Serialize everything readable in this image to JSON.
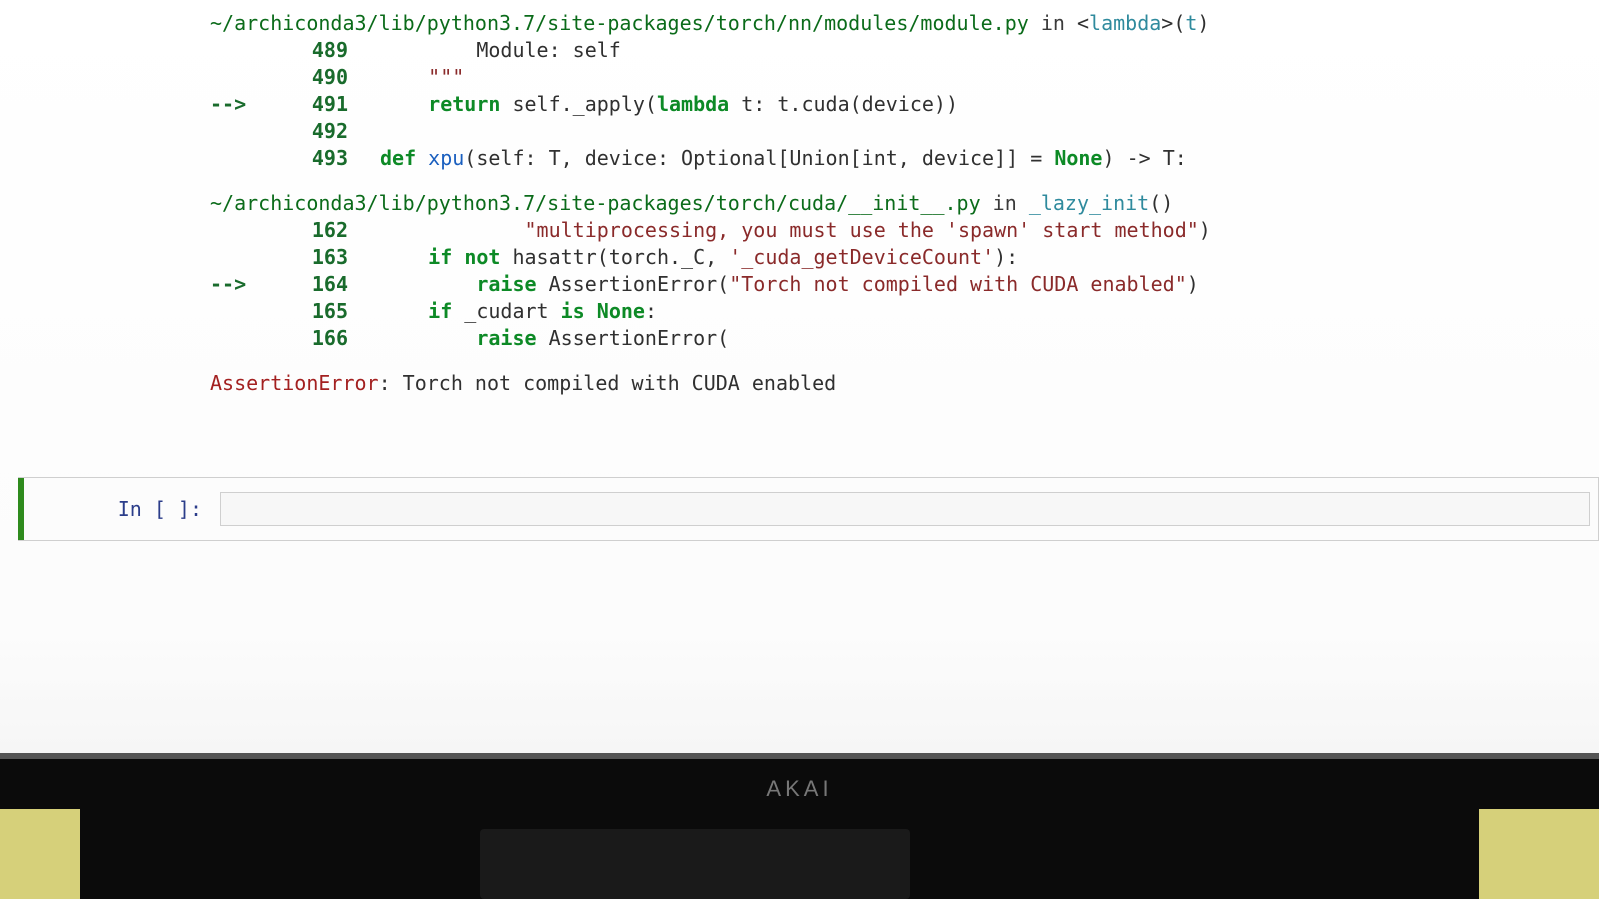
{
  "frames": [
    {
      "path": "~/archiconda3/lib/python3.7/site-packages/torch/nn/modules/module.py",
      "in_word": "in",
      "func_html": "<span class='syntax'>&lt;</span>lambda<span class='syntax'>&gt;(</span>t<span class='syntax'>)</span>",
      "lines": [
        {
          "arrow": "",
          "num": "489",
          "code_html": "        Module: self"
        },
        {
          "arrow": "",
          "num": "490",
          "code_html": "    <span class='str'>\"\"\"</span>"
        },
        {
          "arrow": "-->",
          "num": "491",
          "code_html": "    <span class='kw'>return</span> self._apply(<span class='kw'>lambda</span> t: t.cuda(device))"
        },
        {
          "arrow": "",
          "num": "492",
          "code_html": ""
        },
        {
          "arrow": "",
          "num": "493",
          "code_html": "<span class='kw'>def</span> <span class='def'>xpu</span>(self: T, device: Optional[Union[int, device]] = <span class='kw'>None</span>) -&gt; T:"
        }
      ]
    },
    {
      "path": "~/archiconda3/lib/python3.7/site-packages/torch/cuda/__init__.py",
      "in_word": "in",
      "func_html": "_lazy_init<span class='syntax'>()</span>",
      "lines": [
        {
          "arrow": "",
          "num": "162",
          "code_html": "            <span class='str'>\"multiprocessing, you must use the 'spawn' start method\"</span>)"
        },
        {
          "arrow": "",
          "num": "163",
          "code_html": "    <span class='kw'>if</span> <span class='kw'>not</span> hasattr(torch._C, <span class='str'>'_cuda_getDeviceCount'</span>):"
        },
        {
          "arrow": "-->",
          "num": "164",
          "code_html": "        <span class='kw'>raise</span> AssertionError(<span class='str'>\"Torch not compiled with CUDA enabled\"</span>)"
        },
        {
          "arrow": "",
          "num": "165",
          "code_html": "    <span class='kw'>if</span> _cudart <span class='kw'>is</span> <span class='kw'>None</span>:"
        },
        {
          "arrow": "",
          "num": "166",
          "code_html": "        <span class='kw'>raise</span> AssertionError("
        }
      ]
    }
  ],
  "error": {
    "name": "AssertionError",
    "sep": ": ",
    "msg": "Torch not compiled with CUDA enabled"
  },
  "prompt": {
    "label": "In [ ]:",
    "value": ""
  },
  "monitor": {
    "brand": "AKAI"
  }
}
